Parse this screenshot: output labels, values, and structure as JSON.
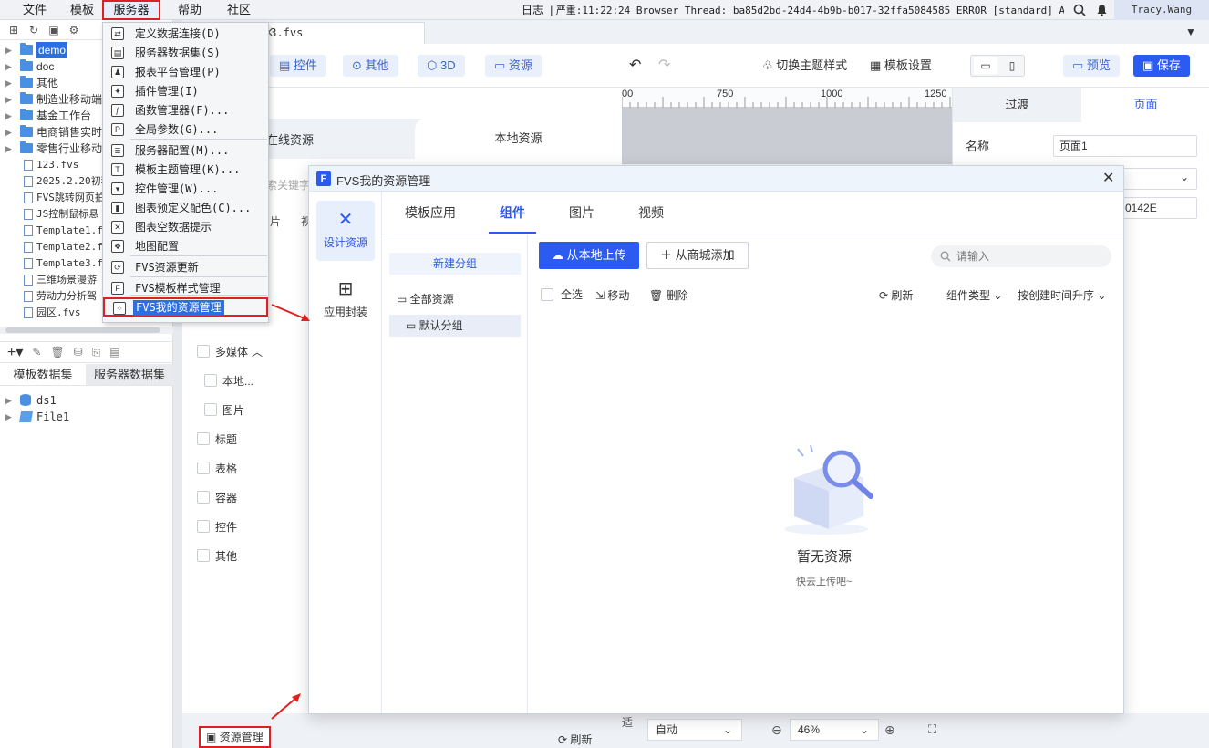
{
  "menubar": {
    "items": [
      "文件",
      "模板",
      "服务器",
      "帮助",
      "社区"
    ],
    "log_prefix": "日志",
    "log_text": "严重:11:22:24 Browser Thread: ba85d2bd-24d4-4b9b-b017-32ffa5084585 ERROR [standard] Access...",
    "user": "Tracy.Wang"
  },
  "tree": {
    "items": [
      {
        "label": "demo",
        "type": "folder",
        "selected": true
      },
      {
        "label": "doc",
        "type": "folder"
      },
      {
        "label": "其他",
        "type": "folder"
      },
      {
        "label": "制造业移动端",
        "type": "folder"
      },
      {
        "label": "基金工作台",
        "type": "folder"
      },
      {
        "label": "电商销售实时",
        "type": "folder"
      },
      {
        "label": "零售行业移动",
        "type": "folder"
      },
      {
        "label": "123.fvs",
        "type": "file"
      },
      {
        "label": "2025.2.20初稿",
        "type": "file"
      },
      {
        "label": "FVS跳转网页拍",
        "type": "file"
      },
      {
        "label": "JS控制鼠标悬",
        "type": "file"
      },
      {
        "label": "Template1.fv",
        "type": "file"
      },
      {
        "label": "Template2.fv",
        "type": "file"
      },
      {
        "label": "Template3.fv",
        "type": "file"
      },
      {
        "label": "三维场景漫游",
        "type": "file"
      },
      {
        "label": "劳动力分析驾",
        "type": "file"
      },
      {
        "label": "园区.fvs",
        "type": "file"
      }
    ]
  },
  "dataset_tabs": {
    "template": "模板数据集",
    "server": "服务器数据集"
  },
  "datasets": [
    "ds1",
    "File1"
  ],
  "doc_tab": {
    "label": "e3.fvs"
  },
  "toolbar": {
    "widget": "控件",
    "other": "其他",
    "three_d": "3D",
    "resource": "资源",
    "theme": "切换主题样式",
    "template_settings": "模板设置",
    "preview": "预览",
    "save": "保存"
  },
  "widget_panel": {
    "tab_online": "在线资源",
    "tab_local": "本地资源",
    "search_partial": "索关键字",
    "subtabs_partial": [
      "片",
      "视"
    ],
    "categories": [
      {
        "label": "多媒体",
        "level": 0,
        "expanded": true
      },
      {
        "label": "本地...",
        "level": 1
      },
      {
        "label": "图片",
        "level": 1
      },
      {
        "label": "标题",
        "level": 0
      },
      {
        "label": "表格",
        "level": 0
      },
      {
        "label": "容器",
        "level": 0
      },
      {
        "label": "控件",
        "level": 0
      },
      {
        "label": "其他",
        "level": 0
      }
    ]
  },
  "ruler": {
    "ticks": [
      "00",
      "750",
      "1000",
      "1250"
    ]
  },
  "right_panel": {
    "tab_transition": "过渡",
    "tab_page": "页面",
    "name_label": "名称",
    "name_value": "页面1",
    "code_value": "0142E"
  },
  "bottom_bar": {
    "resource_manage": "资源管理",
    "refresh": "刷新",
    "fit_partial": "适",
    "auto": "自动",
    "zoom": "46%"
  },
  "server_menu": {
    "items": [
      {
        "icon": "db-connect-icon",
        "glyph": "⇄",
        "label": "定义数据连接(D)"
      },
      {
        "icon": "server-dataset-icon",
        "glyph": "▤",
        "label": "服务器数据集(S)"
      },
      {
        "icon": "user-icon",
        "glyph": "♟",
        "label": "报表平台管理(P)"
      },
      {
        "icon": "plugin-icon",
        "glyph": "✦",
        "label": "插件管理(I)"
      },
      {
        "icon": "function-icon",
        "glyph": "ƒ",
        "label": "函数管理器(F)..."
      },
      {
        "icon": "param-icon",
        "glyph": "P",
        "label": "全局参数(G)..."
      },
      {
        "icon": "server-config-icon",
        "glyph": "≣",
        "label": "服务器配置(M)..."
      },
      {
        "icon": "theme-icon",
        "glyph": "T",
        "label": "模板主题管理(K)..."
      },
      {
        "icon": "widget-manage-icon",
        "glyph": "▾",
        "label": "控件管理(W)..."
      },
      {
        "icon": "chart-color-icon",
        "glyph": "▮",
        "label": "图表预定义配色(C)..."
      },
      {
        "icon": "chart-empty-icon",
        "glyph": "✕",
        "label": "图表空数据提示"
      },
      {
        "icon": "map-config-icon",
        "glyph": "❖",
        "label": "地图配置"
      },
      {
        "icon": "fvs-update-icon",
        "glyph": "⟳",
        "label": "FVS资源更新"
      },
      {
        "icon": "fvs-style-icon",
        "glyph": "F",
        "label": "FVS模板样式管理"
      },
      {
        "icon": "fvs-resource-icon",
        "glyph": "⁘",
        "label": "FVS我的资源管理"
      }
    ]
  },
  "modal": {
    "title": "FVS我的资源管理",
    "side": [
      {
        "label": "设计资源"
      },
      {
        "label": "应用封装"
      }
    ],
    "tabs": [
      "模板应用",
      "组件",
      "图片",
      "视频"
    ],
    "new_group": "新建分组",
    "all_resources": "全部资源",
    "default_group": "默认分组",
    "upload_local": "从本地上传",
    "add_from_store": "从商城添加",
    "search_placeholder": "请输入",
    "select_all": "全选",
    "move": "移动",
    "delete": "删除",
    "refresh": "刷新",
    "type_filter": "组件类型",
    "sort": "按创建时间升序",
    "empty_title": "暂无资源",
    "empty_hint": "快去上传吧~"
  },
  "colors": {
    "accent": "#2b5bf0",
    "highlight_red": "#e02020",
    "selected_blue": "#2b6fe0"
  }
}
